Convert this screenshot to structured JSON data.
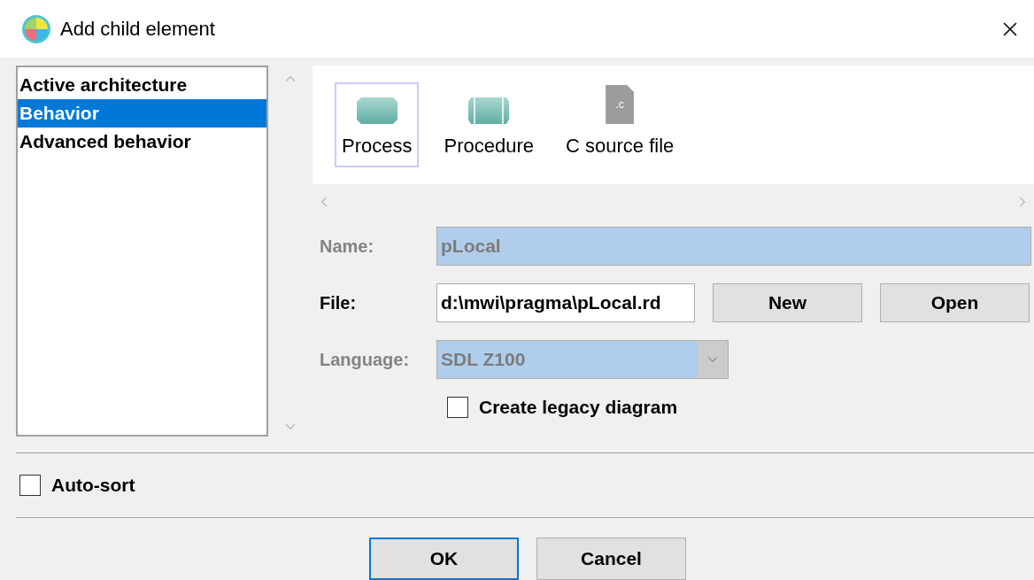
{
  "window": {
    "title": "Add child element"
  },
  "categories": [
    {
      "label": "Active architecture",
      "selected": false
    },
    {
      "label": "Behavior",
      "selected": true
    },
    {
      "label": "Advanced behavior",
      "selected": false
    }
  ],
  "element_types": [
    {
      "label": "Process",
      "kind": "process",
      "selected": true
    },
    {
      "label": "Procedure",
      "kind": "procedure",
      "selected": false
    },
    {
      "label": "C source file",
      "kind": "c-file",
      "selected": false,
      "icon_label": ".c"
    }
  ],
  "form": {
    "name": {
      "label": "Name:",
      "value": "pLocal",
      "disabled": true
    },
    "file": {
      "label": "File:",
      "value": "d:\\mwi\\pragma\\pLocal.rd",
      "disabled": false
    },
    "file_buttons": [
      "New",
      "Open"
    ],
    "language": {
      "label": "Language:",
      "value": "SDL Z100",
      "disabled": true
    },
    "legacy": {
      "label": "Create legacy diagram",
      "checked": false
    }
  },
  "auto_sort": {
    "label": "Auto-sort",
    "checked": false
  },
  "buttons": [
    {
      "label": "OK",
      "default": true
    },
    {
      "label": "Cancel",
      "default": false
    }
  ]
}
